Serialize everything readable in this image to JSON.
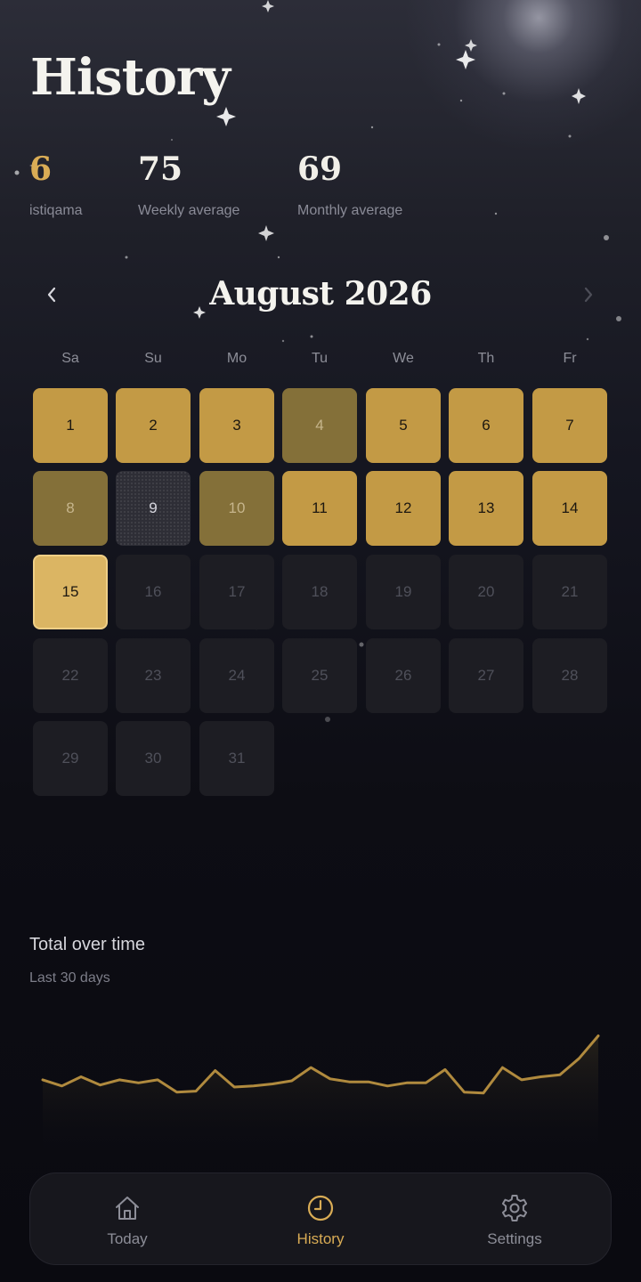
{
  "page": {
    "title": "History"
  },
  "stats": [
    {
      "value": "6",
      "label": "istiqama",
      "highlight": true
    },
    {
      "value": "75",
      "label": "Weekly average",
      "highlight": false
    },
    {
      "value": "69",
      "label": "Monthly average",
      "highlight": false
    }
  ],
  "calendar": {
    "month_label": "August 2026",
    "prev_icon": "chevron-left-icon",
    "next_icon": "chevron-right-icon",
    "weekdays": [
      "Sa",
      "Su",
      "Mo",
      "Tu",
      "We",
      "Th",
      "Fr"
    ],
    "days": [
      {
        "day": "1",
        "status": "full"
      },
      {
        "day": "2",
        "status": "full"
      },
      {
        "day": "3",
        "status": "full"
      },
      {
        "day": "4",
        "status": "partial"
      },
      {
        "day": "5",
        "status": "full"
      },
      {
        "day": "6",
        "status": "full"
      },
      {
        "day": "7",
        "status": "full"
      },
      {
        "day": "8",
        "status": "partial"
      },
      {
        "day": "9",
        "status": "missed"
      },
      {
        "day": "10",
        "status": "partial"
      },
      {
        "day": "11",
        "status": "full"
      },
      {
        "day": "12",
        "status": "full"
      },
      {
        "day": "13",
        "status": "full"
      },
      {
        "day": "14",
        "status": "full"
      },
      {
        "day": "15",
        "status": "today"
      },
      {
        "day": "16",
        "status": "future"
      },
      {
        "day": "17",
        "status": "future"
      },
      {
        "day": "18",
        "status": "future"
      },
      {
        "day": "19",
        "status": "future"
      },
      {
        "day": "20",
        "status": "future"
      },
      {
        "day": "21",
        "status": "future"
      },
      {
        "day": "22",
        "status": "future"
      },
      {
        "day": "23",
        "status": "future"
      },
      {
        "day": "24",
        "status": "future"
      },
      {
        "day": "25",
        "status": "future"
      },
      {
        "day": "26",
        "status": "future"
      },
      {
        "day": "27",
        "status": "future"
      },
      {
        "day": "28",
        "status": "future"
      },
      {
        "day": "29",
        "status": "future"
      },
      {
        "day": "30",
        "status": "future"
      },
      {
        "day": "31",
        "status": "future"
      }
    ]
  },
  "chart_section": {
    "title": "Total over time",
    "subtitle": "Last 30 days"
  },
  "chart_data": {
    "type": "area",
    "title": "Total over time",
    "subtitle": "Last 30 days",
    "xlabel": "",
    "ylabel": "",
    "grid": false,
    "ylim": [
      0,
      100
    ],
    "x": [
      1,
      2,
      3,
      4,
      5,
      6,
      7,
      8,
      9,
      10,
      11,
      12,
      13,
      14,
      15,
      16,
      17,
      18,
      19,
      20,
      21,
      22,
      23,
      24,
      25,
      26,
      27,
      28,
      29,
      30
    ],
    "values": [
      54,
      48,
      57,
      49,
      54,
      51,
      54,
      42,
      43,
      63,
      47,
      48,
      50,
      53,
      66,
      55,
      52,
      52,
      48,
      51,
      51,
      64,
      42,
      41,
      66,
      54,
      57,
      59,
      75,
      97
    ],
    "line_color": "#b08a3e"
  },
  "tabbar": {
    "tabs": [
      {
        "label": "Today",
        "icon": "home-icon",
        "active": false
      },
      {
        "label": "History",
        "icon": "clock-icon",
        "active": true
      },
      {
        "label": "Settings",
        "icon": "gear-icon",
        "active": false
      }
    ],
    "active_color": "#d9ac55",
    "inactive_color": "#8d8e98"
  },
  "colors": {
    "full": "#c39a45",
    "partial": "#847039",
    "missed": "#2e2e36",
    "today": "#dbb563",
    "future": "#1d1d23",
    "accent": "#d9ac55"
  }
}
